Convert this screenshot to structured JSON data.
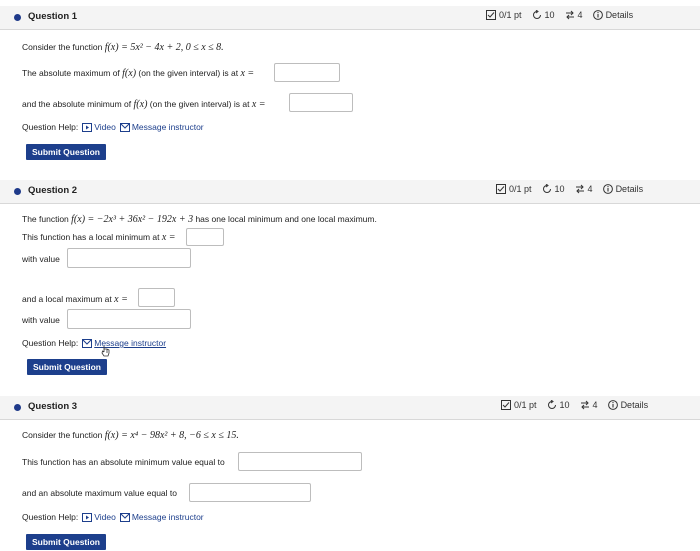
{
  "q1": {
    "title": "Question 1",
    "points": "0/1 pt",
    "retries": "10",
    "attempts": "4",
    "details": "Details",
    "line1_pre": "Consider the function ",
    "line1_math": "f(x) = 5x² − 4x + 2,  0 ≤ x ≤ 8.",
    "line2_pre": "The absolute maximum of ",
    "line2_math": "f(x)",
    "line2_post": " (on the given interval) is at ",
    "line2_var": "x =",
    "line3_pre": "and the absolute minimum of ",
    "line3_math": "f(x)",
    "line3_post": " (on the given interval) is at ",
    "line3_var": "x =",
    "help_label": "Question Help:",
    "video_label": "Video",
    "message_label": "Message instructor",
    "submit_label": "Submit Question"
  },
  "q2": {
    "title": "Question 2",
    "points": "0/1 pt",
    "retries": "10",
    "attempts": "4",
    "details": "Details",
    "line1_pre": "The function ",
    "line1_math": "f(x) = −2x³ + 36x² − 192x + 3",
    "line1_post": " has one local minimum and one local maximum.",
    "line2_pre": "This function has a local minimum at ",
    "line2_var": "x =",
    "line3": "with value",
    "line4_pre": "and a local maximum at ",
    "line4_var": "x =",
    "line5": "with value",
    "help_label": "Question Help:",
    "message_label": "Message instructor",
    "submit_label": "Submit Question"
  },
  "q3": {
    "title": "Question 3",
    "points": "0/1 pt",
    "retries": "10",
    "attempts": "4",
    "details": "Details",
    "line1_pre": "Consider the function ",
    "line1_math": "f(x) = x⁴ − 98x² + 8,   −6 ≤ x ≤ 15.",
    "line2": "This function has an absolute minimum value equal to",
    "line3": "and an absolute maximum value equal to",
    "help_label": "Question Help:",
    "video_label": "Video",
    "message_label": "Message instructor",
    "submit_label": "Submit Question"
  },
  "colors": {
    "accent": "#1d3f8c",
    "dot": "#1f3a8a"
  }
}
